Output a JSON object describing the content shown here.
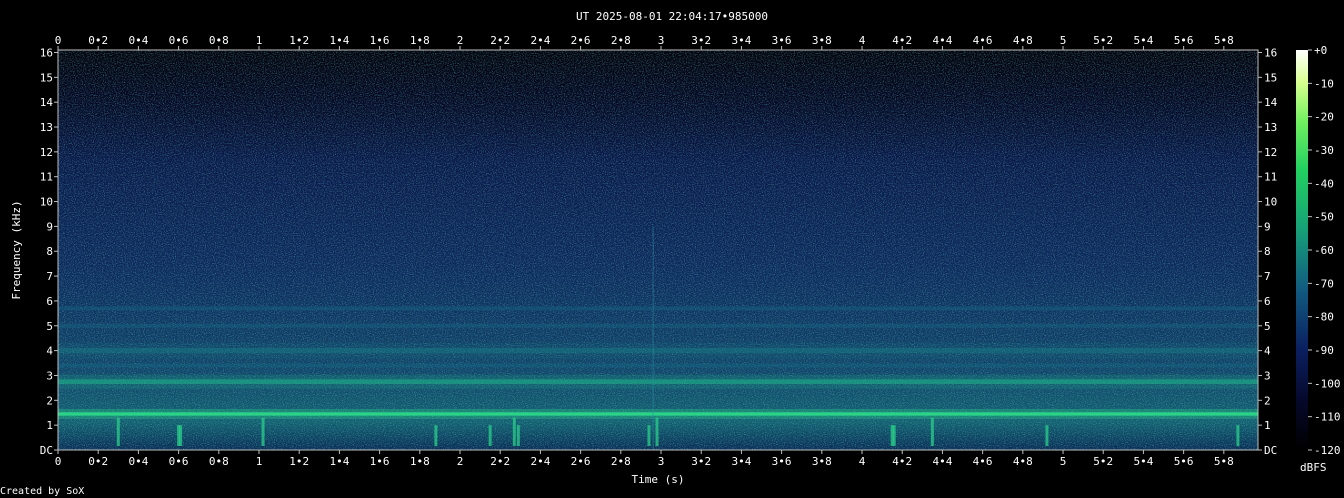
{
  "chart_data": {
    "type": "heatmap",
    "title": "UT 2025-08-01 22:04:17•985000",
    "xlabel": "Time (s)",
    "ylabel": "Frequency (kHz)",
    "xlim": [
      0,
      5.97
    ],
    "ylim": [
      0,
      16.1
    ],
    "x_ticks": [
      "0",
      "0•2",
      "0•4",
      "0•6",
      "0•8",
      "1",
      "1•2",
      "1•4",
      "1•6",
      "1•8",
      "2",
      "2•2",
      "2•4",
      "2•6",
      "2•8",
      "3",
      "3•2",
      "3•4",
      "3•6",
      "3•8",
      "4",
      "4•2",
      "4•4",
      "4•6",
      "4•8",
      "5",
      "5•2",
      "5•4",
      "5•6",
      "5•8"
    ],
    "y_ticks": [
      "DC",
      "1",
      "2",
      "3",
      "4",
      "5",
      "6",
      "7",
      "8",
      "9",
      "10",
      "11",
      "12",
      "13",
      "14",
      "15",
      "16"
    ],
    "colorbar": {
      "label": "dBFS",
      "ticks": [
        "+0",
        "-10",
        "-20",
        "-30",
        "-40",
        "-50",
        "-60",
        "-70",
        "-80",
        "-90",
        "-100",
        "-110",
        "-120"
      ],
      "range": [
        -120,
        0
      ]
    },
    "bands_khz": [
      1.45,
      2.75,
      4.0
    ],
    "background_level_dbfs": -95,
    "colors": [
      "#000000",
      "#0a1a55",
      "#115a80",
      "#1aa878",
      "#30e070",
      "#a0ff60",
      "#ffffff"
    ]
  },
  "credit": "Created by SoX"
}
